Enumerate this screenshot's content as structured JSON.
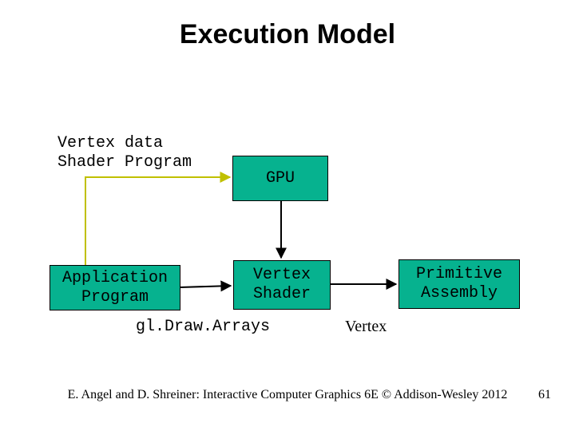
{
  "title": "Execution Model",
  "labels": {
    "vertex_data": "Vertex data",
    "shader_program": "Shader Program",
    "gl_draw_arrays": "gl.Draw.Arrays",
    "vertex_out": "Vertex"
  },
  "nodes": {
    "gpu": "GPU",
    "application_program": "Application\nProgram",
    "vertex_shader": "Vertex\nShader",
    "primitive_assembly": "Primitive\nAssembly"
  },
  "footer": "E. Angel and D. Shreiner: Interactive Computer Graphics 6E © Addison-Wesley 2012",
  "page_number": "61",
  "colors": {
    "box_fill": "#06b28f",
    "box_stroke": "#000000",
    "arrow_to_gpu": "#c0c000",
    "arrow_default": "#000000"
  }
}
